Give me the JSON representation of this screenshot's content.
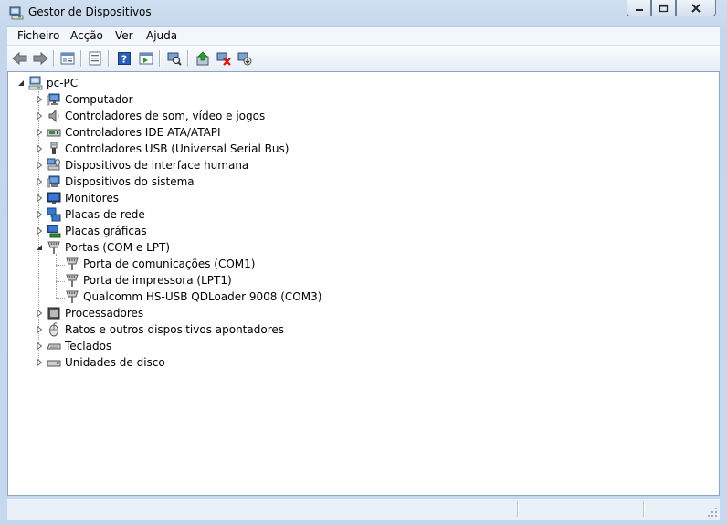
{
  "window": {
    "title": "Gestor de Dispositivos"
  },
  "menu": {
    "items": [
      "Ficheiro",
      "Acção",
      "Ver",
      "Ajuda"
    ]
  },
  "toolbar": {
    "buttons": [
      "back-icon",
      "forward-icon",
      "console-tree-icon",
      "properties-icon",
      "help-icon",
      "action-pane-icon",
      "scan-hardware-icon",
      "update-driver-icon",
      "uninstall-icon",
      "disable-icon"
    ]
  },
  "tree": {
    "root": "pc-PC",
    "categories": [
      {
        "label": "Computador",
        "icon": "computer-icon",
        "expanded": false
      },
      {
        "label": "Controladores de som, vídeo e jogos",
        "icon": "speaker-icon",
        "expanded": false
      },
      {
        "label": "Controladores IDE ATA/ATAPI",
        "icon": "ide-controller-icon",
        "expanded": false
      },
      {
        "label": "Controladores USB (Universal Serial Bus)",
        "icon": "usb-icon",
        "expanded": false
      },
      {
        "label": "Dispositivos de interface humana",
        "icon": "hid-icon",
        "expanded": false
      },
      {
        "label": "Dispositivos do sistema",
        "icon": "system-device-icon",
        "expanded": false
      },
      {
        "label": "Monitores",
        "icon": "monitor-icon",
        "expanded": false
      },
      {
        "label": "Placas de rede",
        "icon": "network-adapter-icon",
        "expanded": false
      },
      {
        "label": "Placas gráficas",
        "icon": "display-adapter-icon",
        "expanded": false
      },
      {
        "label": "Portas (COM e LPT)",
        "icon": "port-icon",
        "expanded": true,
        "children": [
          "Porta de comunicações (COM1)",
          "Porta de impressora (LPT1)",
          "Qualcomm HS-USB QDLoader 9008 (COM3)"
        ]
      },
      {
        "label": "Processadores",
        "icon": "processor-icon",
        "expanded": false
      },
      {
        "label": "Ratos e outros dispositivos apontadores",
        "icon": "mouse-icon",
        "expanded": false
      },
      {
        "label": "Teclados",
        "icon": "keyboard-icon",
        "expanded": false
      },
      {
        "label": "Unidades de disco",
        "icon": "disk-drive-icon",
        "expanded": false
      }
    ]
  },
  "colors": {
    "frame": "#c6d8ee",
    "tree_bg": "#ffffff",
    "menu_bg": "#f3f6fa"
  }
}
